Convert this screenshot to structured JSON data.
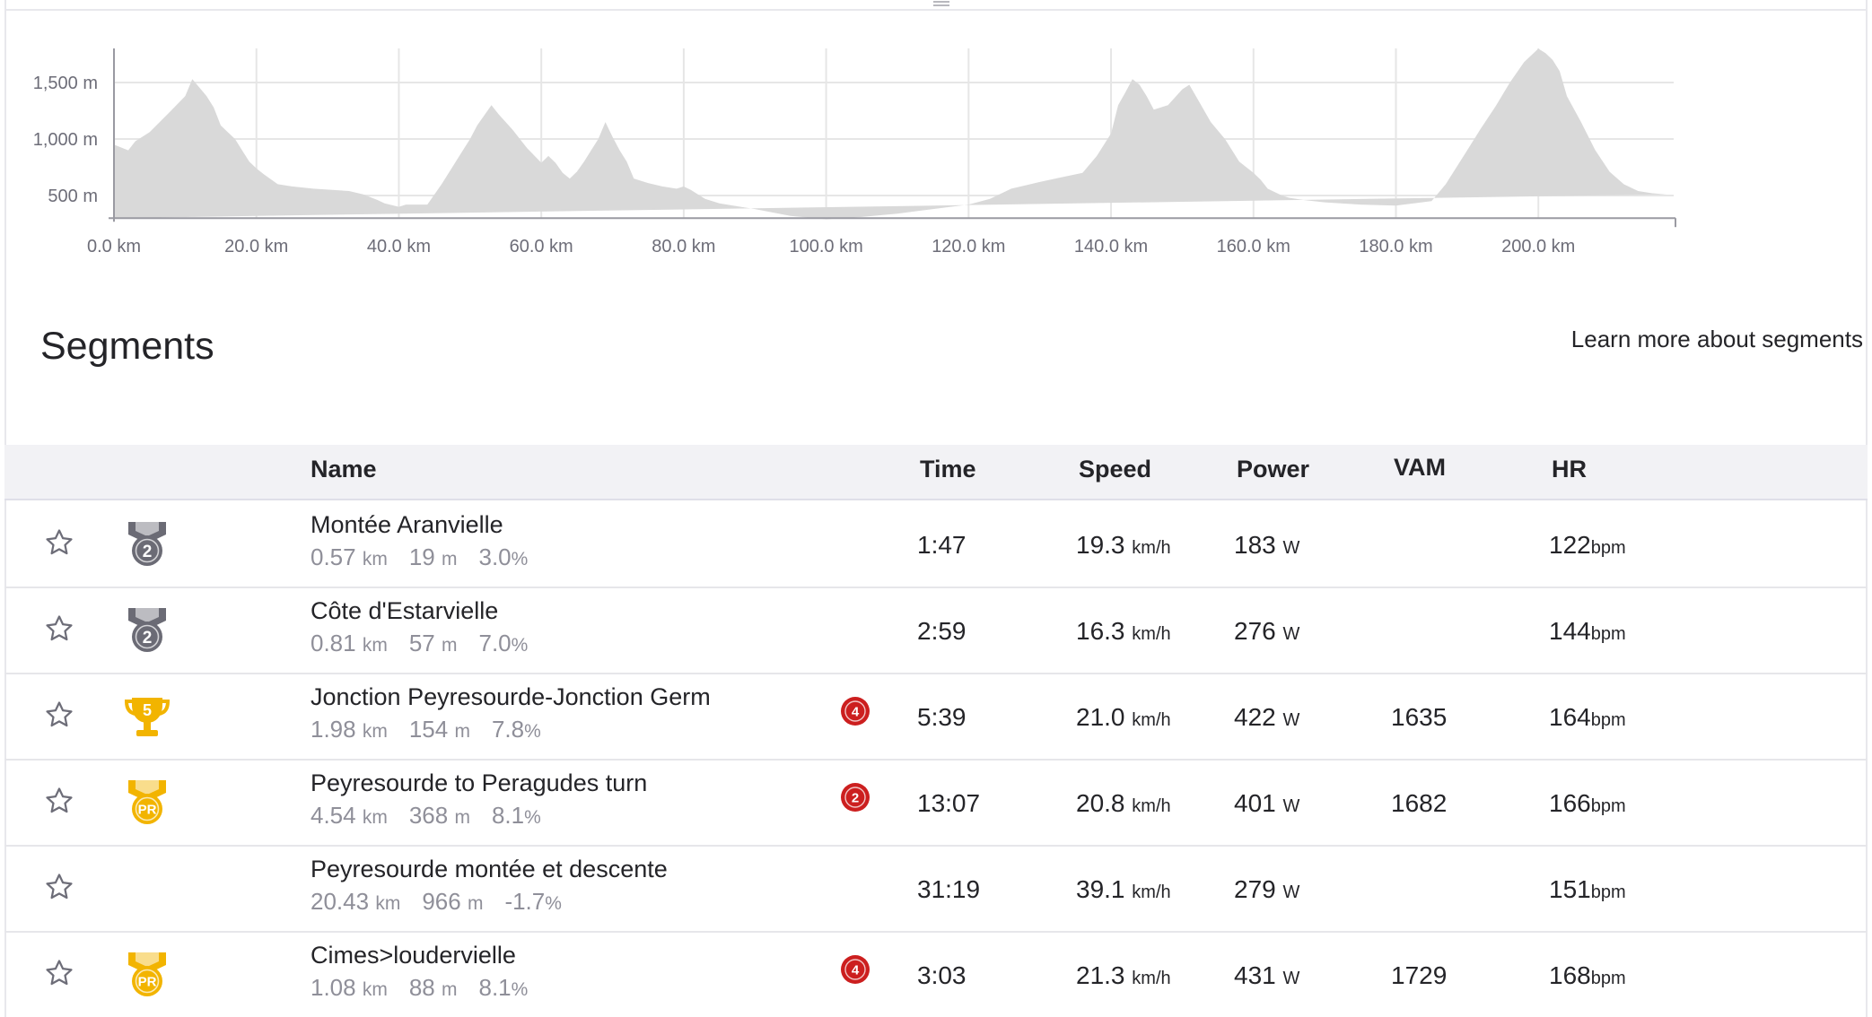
{
  "elevation": {
    "y_ticks": [
      "1,500 m",
      "1,000 m",
      "500 m"
    ],
    "x_ticks": [
      "0.0 km",
      "20.0 km",
      "40.0 km",
      "60.0 km",
      "80.0 km",
      "100.0 km",
      "120.0 km",
      "140.0 km",
      "160.0 km",
      "180.0 km",
      "200.0 km"
    ],
    "fill_color": "#d9d9d9",
    "grid_color": "#e6e6e6",
    "profile_km": [
      0,
      2,
      3,
      5,
      8,
      10,
      11,
      13,
      14,
      15,
      17,
      18,
      19,
      20,
      21,
      23,
      25,
      28,
      33,
      35,
      37,
      38,
      40,
      41,
      44,
      46,
      48,
      50,
      51,
      52,
      53,
      54,
      56,
      58,
      60,
      61,
      62,
      63,
      64,
      65,
      66,
      67,
      68,
      69,
      70,
      71,
      72,
      73,
      75,
      77,
      79,
      80,
      81,
      83,
      85,
      88,
      90,
      95,
      100,
      105,
      110,
      115,
      120,
      123,
      126,
      130,
      133,
      136,
      138,
      140,
      141,
      142,
      143,
      144,
      145,
      146,
      148,
      150,
      151,
      152,
      154,
      156,
      158,
      160,
      161,
      162,
      163,
      164,
      165,
      167,
      170,
      175,
      180,
      185,
      187,
      188,
      190,
      192,
      194,
      196,
      198,
      200,
      201,
      202,
      203,
      204,
      206,
      208,
      210,
      212,
      214,
      216,
      218,
      219
    ],
    "profile_m": [
      950,
      900,
      980,
      1060,
      1250,
      1380,
      1530,
      1380,
      1280,
      1120,
      1000,
      900,
      800,
      740,
      690,
      600,
      580,
      560,
      540,
      510,
      460,
      430,
      400,
      420,
      420,
      600,
      800,
      1000,
      1120,
      1210,
      1300,
      1220,
      1080,
      920,
      790,
      850,
      790,
      700,
      650,
      710,
      800,
      900,
      1000,
      1150,
      1020,
      900,
      800,
      650,
      610,
      580,
      560,
      580,
      550,
      470,
      430,
      400,
      380,
      320,
      290,
      310,
      340,
      380,
      420,
      470,
      560,
      620,
      660,
      700,
      850,
      1050,
      1300,
      1410,
      1530,
      1480,
      1380,
      1260,
      1300,
      1440,
      1480,
      1370,
      1150,
      1000,
      800,
      700,
      640,
      560,
      530,
      500,
      480,
      460,
      440,
      420,
      410,
      450,
      600,
      700,
      900,
      1100,
      1290,
      1500,
      1680,
      1800,
      1760,
      1700,
      1600,
      1380,
      1150,
      900,
      710,
      600,
      540,
      520,
      510
    ]
  },
  "segments_title": "Segments",
  "learn_more": "Learn more about segments",
  "columns": {
    "name": "Name",
    "time": "Time",
    "speed": "Speed",
    "power": "Power",
    "vam": "VAM",
    "hr": "HR"
  },
  "units": {
    "km": "km",
    "m": "m",
    "pct": "%",
    "kmh": "km/h",
    "w": "W",
    "bpm": "bpm"
  },
  "colors": {
    "silver_medal": "#6b6b75",
    "gold_medal": "#f2b400",
    "kom_badge": "#cc1f1f",
    "text": "#242428",
    "muted": "#8f8f99"
  },
  "segments": [
    {
      "name": "Montée Aranvielle",
      "distance": "0.57",
      "elevation": "19",
      "grade": "3.0",
      "medal": "silver-2-icon",
      "medal_text": "2",
      "badge": "",
      "time": "1:47",
      "speed": "19.3",
      "power": "183",
      "vam": "",
      "hr": "122"
    },
    {
      "name": "Côte d'Estarvielle",
      "distance": "0.81",
      "elevation": "57",
      "grade": "7.0",
      "medal": "silver-2-icon",
      "medal_text": "2",
      "badge": "",
      "time": "2:59",
      "speed": "16.3",
      "power": "276",
      "vam": "",
      "hr": "144"
    },
    {
      "name": "Jonction Peyresourde-Jonction Germ",
      "distance": "1.98",
      "elevation": "154",
      "grade": "7.8",
      "medal": "trophy-5-icon",
      "medal_text": "5",
      "badge": "4",
      "time": "5:39",
      "speed": "21.0",
      "power": "422",
      "vam": "1635",
      "hr": "164"
    },
    {
      "name": "Peyresourde to Peragudes turn",
      "distance": "4.54",
      "elevation": "368",
      "grade": "8.1",
      "medal": "pr-medal-icon",
      "medal_text": "PR",
      "badge": "2",
      "time": "13:07",
      "speed": "20.8",
      "power": "401",
      "vam": "1682",
      "hr": "166"
    },
    {
      "name": "Peyresourde montée et descente",
      "distance": "20.43",
      "elevation": "966",
      "grade": "-1.7",
      "medal": "",
      "medal_text": "",
      "badge": "",
      "time": "31:19",
      "speed": "39.1",
      "power": "279",
      "vam": "",
      "hr": "151"
    },
    {
      "name": "Cimes>loudervielle",
      "distance": "1.08",
      "elevation": "88",
      "grade": "8.1",
      "medal": "pr-medal-icon",
      "medal_text": "PR",
      "badge": "4",
      "time": "3:03",
      "speed": "21.3",
      "power": "431",
      "vam": "1729",
      "hr": "168"
    }
  ]
}
